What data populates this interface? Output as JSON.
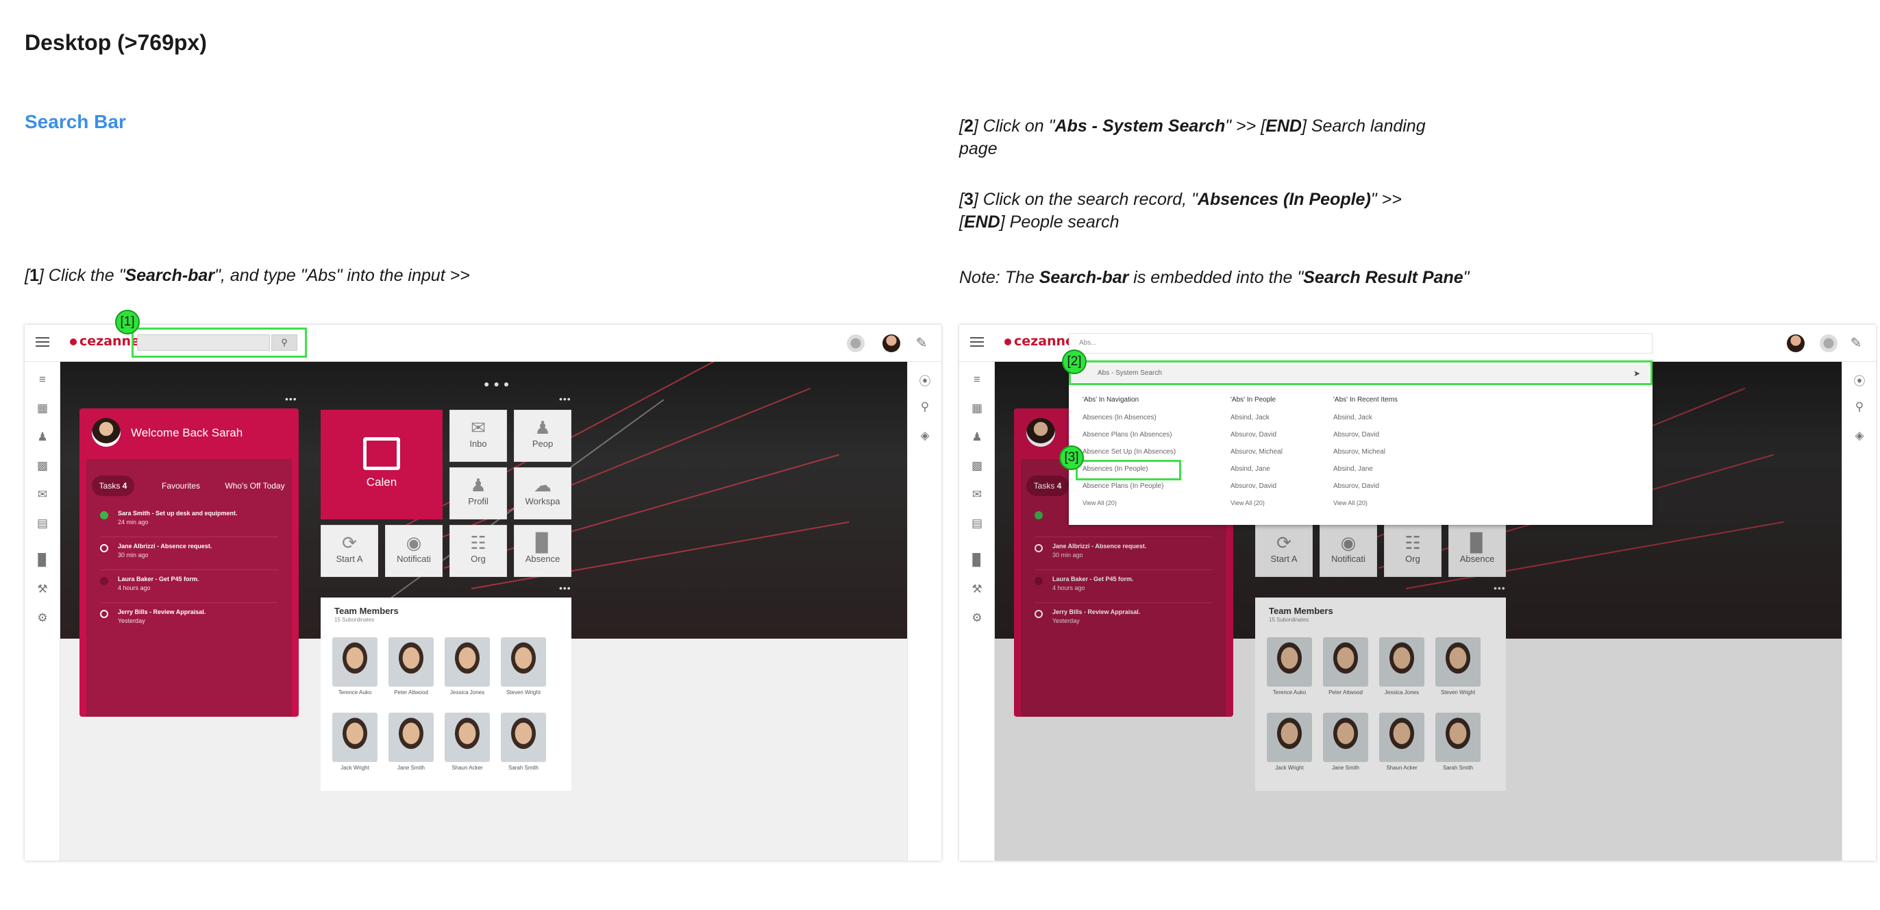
{
  "page_title": "Desktop (>769px)",
  "section_title": "Search Bar",
  "instruction_1": {
    "num": "1",
    "parts": [
      " Click  the \"",
      "Search-bar",
      "\", and type \"Abs\" into the input >>"
    ]
  },
  "instruction_2": {
    "num": "2",
    "parts": [
      " Click on \"",
      "Abs - System Search",
      "\" >> [",
      "END",
      "] Search landing",
      "page"
    ]
  },
  "instruction_3": {
    "num": "3",
    "parts": [
      " Click on the search record, \"",
      "Absences (In People)",
      "\"  >>",
      "END",
      "] People search"
    ]
  },
  "note": {
    "parts": [
      "Note: The  ",
      "Search-bar",
      " is embedded into the \"",
      "Search Result Pane",
      "\""
    ]
  },
  "app": {
    "logo": "cezanne",
    "welcome_title": "Welcome Back Sarah",
    "tabs": [
      {
        "label": "Tasks",
        "count": "4"
      },
      {
        "label": "Favourites"
      },
      {
        "label": "Who's Off Today"
      }
    ],
    "tasks": [
      {
        "title": "Sara Smith - Set up desk and equipment.",
        "time": "24 min ago"
      },
      {
        "title": "Jane Albrizzi - Absence request.",
        "time": "30 min ago"
      },
      {
        "title": "Laura Baker - Get P45 form.",
        "time": "4 hours ago"
      },
      {
        "title": "Jerry Bills - Review Appraisal.",
        "time": "Yesterday"
      }
    ],
    "calendar_label": "Calen",
    "tiles": [
      "Inbo",
      "Peop",
      "Profil",
      "Workspa",
      "Start A",
      "Notificati",
      "Org",
      "Absence"
    ],
    "team_title": "Team Members",
    "team_sub": "15 Subordinates",
    "members": [
      "Terence Auko",
      "Peter Attwood",
      "Jessica Jones",
      "Steven Wright",
      "Jack Wright",
      "Jane Smith",
      "Shaun Acker",
      "Sarah Smith"
    ]
  },
  "search": {
    "value": "Abs...",
    "system_search": "Abs - System Search",
    "columns": [
      {
        "heading": "'Abs' In Navigation",
        "items": [
          "Absences (In Absences)",
          "Absence Plans (In Absences)",
          "Absence Set Up (In Absences)",
          "Absences (In People)",
          "Absence Plans (In People)",
          "View All (20)"
        ]
      },
      {
        "heading": "'Abs' In People",
        "items": [
          "Absind, Jack",
          "Absurov, David",
          "Absurov, Micheal",
          "Absind, Jane",
          "Absurov, David",
          "View All (20)"
        ]
      },
      {
        "heading": "'Abs' In Recent Items",
        "items": [
          "Absind, Jack",
          "Absurov, David",
          "Absurov, Micheal",
          "Absind, Jane",
          "Absurov, David",
          "View All (20)"
        ]
      }
    ]
  },
  "callouts": [
    "[1]",
    "[2]",
    "[3]"
  ],
  "colors": {
    "brand": "#c8104a",
    "link": "#3b8fe8",
    "callout": "#2ee33a"
  }
}
